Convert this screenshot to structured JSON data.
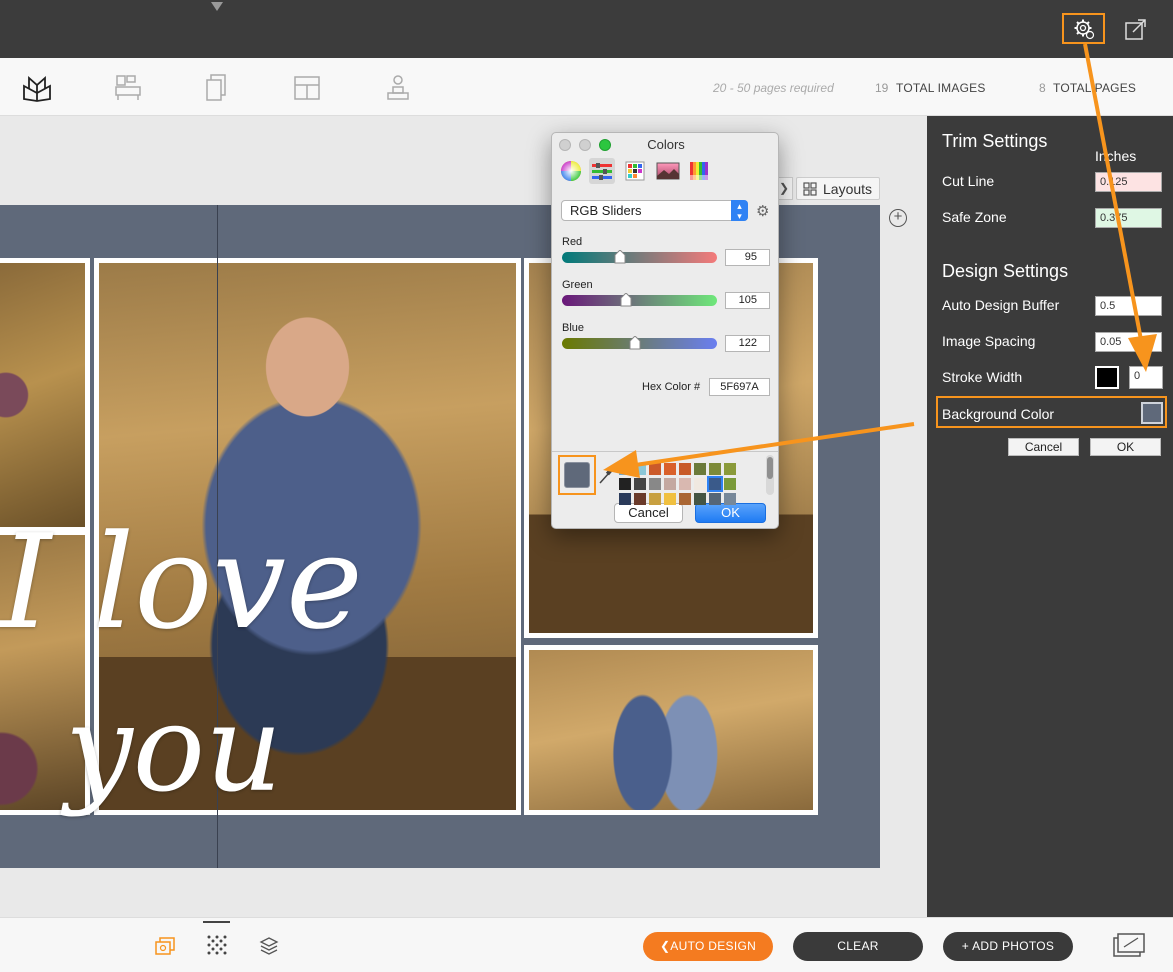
{
  "toolbar": {
    "pages_required": "20 - 50 pages required",
    "total_images_count": "19",
    "total_images_label": "TOTAL IMAGES",
    "total_pages_count": "8",
    "total_pages_label": "TOTAL PAGES",
    "icons": [
      "book-open-icon",
      "furniture-icon",
      "pages-icon",
      "layout-icon",
      "stamp-icon"
    ]
  },
  "workspace": {
    "layouts_label": "Layouts",
    "overlay_text_line1": "I love",
    "overlay_text_line2": "you",
    "background_color": "#5F697A"
  },
  "right_panel": {
    "trim_heading": "Trim Settings",
    "units_label": "Inches",
    "cut_line_label": "Cut Line",
    "cut_line_value": "0.125",
    "safe_zone_label": "Safe Zone",
    "safe_zone_value": "0.375",
    "design_heading": "Design Settings",
    "auto_buffer_label": "Auto Design Buffer",
    "auto_buffer_value": "0.5",
    "image_spacing_label": "Image Spacing",
    "image_spacing_value": "0.05",
    "stroke_width_label": "Stroke Width",
    "stroke_width_value": "0",
    "stroke_color": "#000000",
    "background_color_label": "Background Color",
    "cancel_label": "Cancel",
    "ok_label": "OK"
  },
  "color_picker": {
    "title": "Colors",
    "mode": "RGB Sliders",
    "red_label": "Red",
    "red_value": "95",
    "green_label": "Green",
    "green_value": "105",
    "blue_label": "Blue",
    "blue_value": "122",
    "hex_label": "Hex Color #",
    "hex_value": "5F697A",
    "cancel_label": "Cancel",
    "ok_label": "OK"
  },
  "bottom_bar": {
    "auto_design_label": "AUTO DESIGN",
    "clear_label": "CLEAR",
    "add_photos_label": "+ ADD PHOTOS"
  },
  "colors": {
    "accent": "#f7941d",
    "panel_dark": "#3b3b3b",
    "top_bar": "#3c3c3c",
    "pill_dark": "#3a3a3a"
  }
}
